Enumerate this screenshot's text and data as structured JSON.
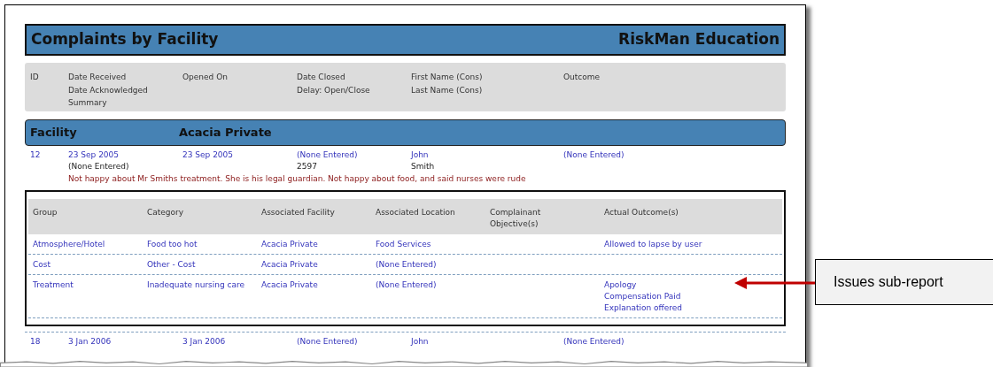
{
  "report": {
    "title": "Complaints by Facility",
    "organization": "RiskMan Education"
  },
  "columns": [
    {
      "lines": [
        "ID"
      ]
    },
    {
      "lines": [
        "Date Received",
        "Date Acknowledged",
        "Summary"
      ]
    },
    {
      "lines": [
        "Opened On"
      ]
    },
    {
      "lines": [
        "Date Closed",
        "Delay: Open/Close"
      ]
    },
    {
      "lines": [
        "First Name (Cons)",
        "Last Name (Cons)"
      ]
    },
    {
      "lines": [
        "Outcome"
      ]
    }
  ],
  "group": {
    "label": "Facility",
    "value": "Acacia Private"
  },
  "records": [
    {
      "cells": [
        {
          "value": "12"
        },
        {
          "value": "23 Sep 2005",
          "sub": "(None Entered)"
        },
        {
          "value": "23 Sep 2005"
        },
        {
          "value": "(None Entered)",
          "sub": "2597"
        },
        {
          "value": "John",
          "sub": "Smith"
        },
        {
          "value": "(None Entered)"
        }
      ],
      "summary": "Not happy about Mr Smiths treatment. She is his legal guardian. Not happy about food, and said nurses were rude",
      "issues": {
        "columns": [
          "Group",
          "Category",
          "Associated Facility",
          "Associated Location",
          "Complainant Objective(s)",
          "Actual Outcome(s)"
        ],
        "rows": [
          {
            "group": "Atmosphere/Hotel",
            "category": "Food too hot",
            "facility": "Acacia Private",
            "location": "Food Services",
            "outcomes": [
              "Allowed to lapse by user"
            ]
          },
          {
            "group": "Cost",
            "category": "Other - Cost",
            "facility": "Acacia Private",
            "location": "(None Entered)"
          },
          {
            "group": "Treatment",
            "category": "Inadequate nursing care",
            "facility": "Acacia Private",
            "location": "(None Entered)",
            "outcomes": [
              "Apology",
              "Compensation Paid",
              "Explanation offered"
            ]
          }
        ]
      }
    },
    {
      "cells": [
        {
          "value": "18"
        },
        {
          "value": "3 Jan 2006"
        },
        {
          "value": "3 Jan 2006"
        },
        {
          "value": "(None Entered)"
        },
        {
          "value": "John"
        },
        {
          "value": "(None Entered)"
        }
      ]
    }
  ],
  "callout": {
    "text": "Issues sub-report"
  }
}
